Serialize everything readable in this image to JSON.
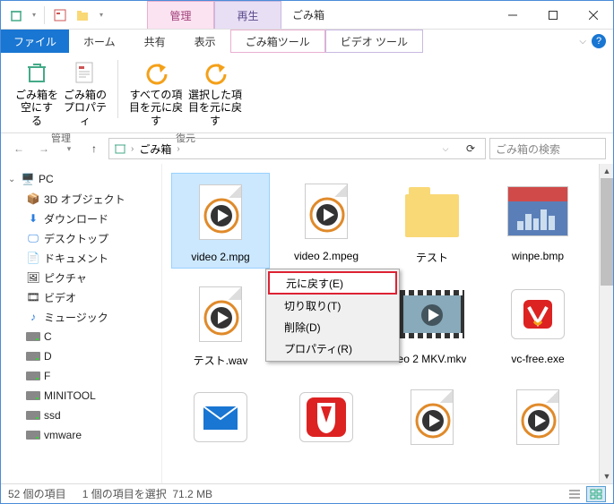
{
  "window": {
    "title": "ごみ箱"
  },
  "contextual_tabs": [
    {
      "header": "管理",
      "label": "ごみ箱ツール"
    },
    {
      "header": "再生",
      "label": "ビデオ ツール"
    }
  ],
  "ribbon_tabs": {
    "file": "ファイル",
    "home": "ホーム",
    "share": "共有",
    "view": "表示"
  },
  "ribbon": {
    "manage_group": "管理",
    "restore_group": "復元",
    "empty": "ごみ箱を空にする",
    "props": "ごみ箱のプロパティ",
    "restore_all": "すべての項目を元に戻す",
    "restore_selected": "選択した項目を元に戻す"
  },
  "address": {
    "location_root_icon": "recycle",
    "segment1": "ごみ箱"
  },
  "search": {
    "placeholder": "ごみ箱の検索"
  },
  "tree": {
    "pc": "PC",
    "items": [
      "3D オブジェクト",
      "ダウンロード",
      "デスクトップ",
      "ドキュメント",
      "ピクチャ",
      "ビデオ",
      "ミュージック",
      "C",
      "D",
      "F",
      "MINITOOL",
      "ssd",
      "vmware"
    ]
  },
  "files": {
    "row1": [
      "video 2.mpg",
      "video 2.mpeg",
      "テスト",
      "winpe.bmp"
    ],
    "row2": [
      "テスト.wav",
      "",
      "eo 2 MKV.mkv",
      "vc-free.exe"
    ],
    "row3": [
      "",
      "",
      "",
      ""
    ]
  },
  "context_menu": {
    "restore": "元に戻す(E)",
    "cut": "切り取り(T)",
    "delete": "削除(D)",
    "properties": "プロパティ(R)"
  },
  "status": {
    "count": "52 個の項目",
    "selected": "1 個の項目を選択",
    "size": "71.2 MB"
  }
}
